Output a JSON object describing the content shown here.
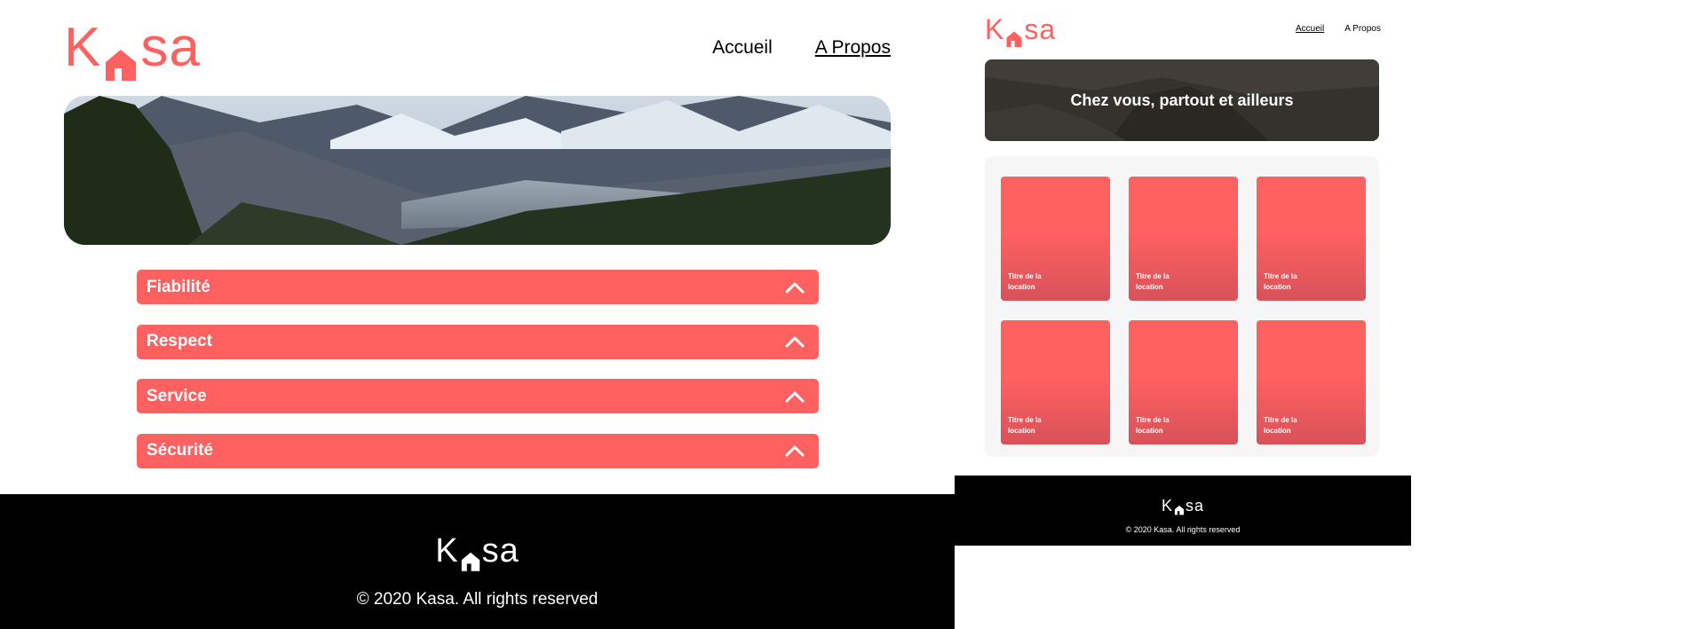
{
  "brand": {
    "logo_k": "K",
    "logo_rest": "sa",
    "accent_color": "#FF6060"
  },
  "about_page": {
    "nav": {
      "home_label": "Accueil",
      "about_label": "A Propos"
    },
    "collapses": [
      {
        "label": "Fiabilité",
        "icon": "chevron-up-icon"
      },
      {
        "label": "Respect",
        "icon": "chevron-up-icon"
      },
      {
        "label": "Service",
        "icon": "chevron-up-icon"
      },
      {
        "label": "Sécurité",
        "icon": "chevron-up-icon"
      }
    ],
    "footer": {
      "copyright": "© 2020 Kasa. All rights reserved"
    }
  },
  "home_page": {
    "nav": {
      "home_label": "Accueil",
      "about_label": "A Propos"
    },
    "banner_title": "Chez vous, partout et ailleurs",
    "cards": [
      {
        "title": "Titre de la location"
      },
      {
        "title": "Titre de la location"
      },
      {
        "title": "Titre de la location"
      },
      {
        "title": "Titre de la location"
      },
      {
        "title": "Titre de la location"
      },
      {
        "title": "Titre de la location"
      }
    ],
    "footer": {
      "copyright": "© 2020 Kasa. All rights reserved"
    }
  }
}
